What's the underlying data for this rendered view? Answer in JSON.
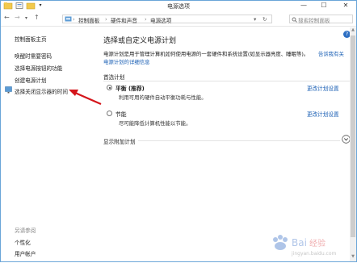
{
  "window": {
    "title": "电源选项",
    "minimize": "—",
    "maximize": "☐",
    "close": "✕"
  },
  "address": {
    "back": "←",
    "forward": "→",
    "recent": "▾",
    "up": "↑",
    "crumbs": [
      "控制面板",
      "硬件和声音",
      "电源选项"
    ],
    "separator": "›",
    "dropdown": "▾",
    "refresh": "↻",
    "search_placeholder": "搜索控制面板"
  },
  "sidebar": {
    "home": "控制面板主页",
    "items": [
      "唤醒时需要密码",
      "选择电源按钮的功能",
      "创建电源计划",
      "选择关闭显示器的时间"
    ],
    "see_also_title": "另请参阅",
    "see_also": [
      "个性化",
      "用户帐户"
    ]
  },
  "main": {
    "heading": "选择或自定义电源计划",
    "desc_line1": "电源计划是用于管理计算机如何使用电源的一套硬件和系统设置(如显示器亮度、睡眠等)。",
    "desc_link_part": "告诉我有关",
    "desc_line2_link": "电源计划的详细信息",
    "preferred_label": "首选计划",
    "plans": [
      {
        "name": "平衡 (推荐)",
        "desc": "利用可用的硬件自动平衡功耗与性能。",
        "change": "更改计划设置",
        "selected": true
      },
      {
        "name": "节能",
        "desc": "尽可能降低计算机性能以节能。",
        "change": "更改计划设置",
        "selected": false
      }
    ],
    "show_more": "显示附加计划",
    "show_more_icon": "chevron-down-icon",
    "help": "?"
  },
  "colors": {
    "link": "#1a5fb4",
    "annotation_arrow": "#d4151b",
    "border": "#6aa5d8"
  }
}
